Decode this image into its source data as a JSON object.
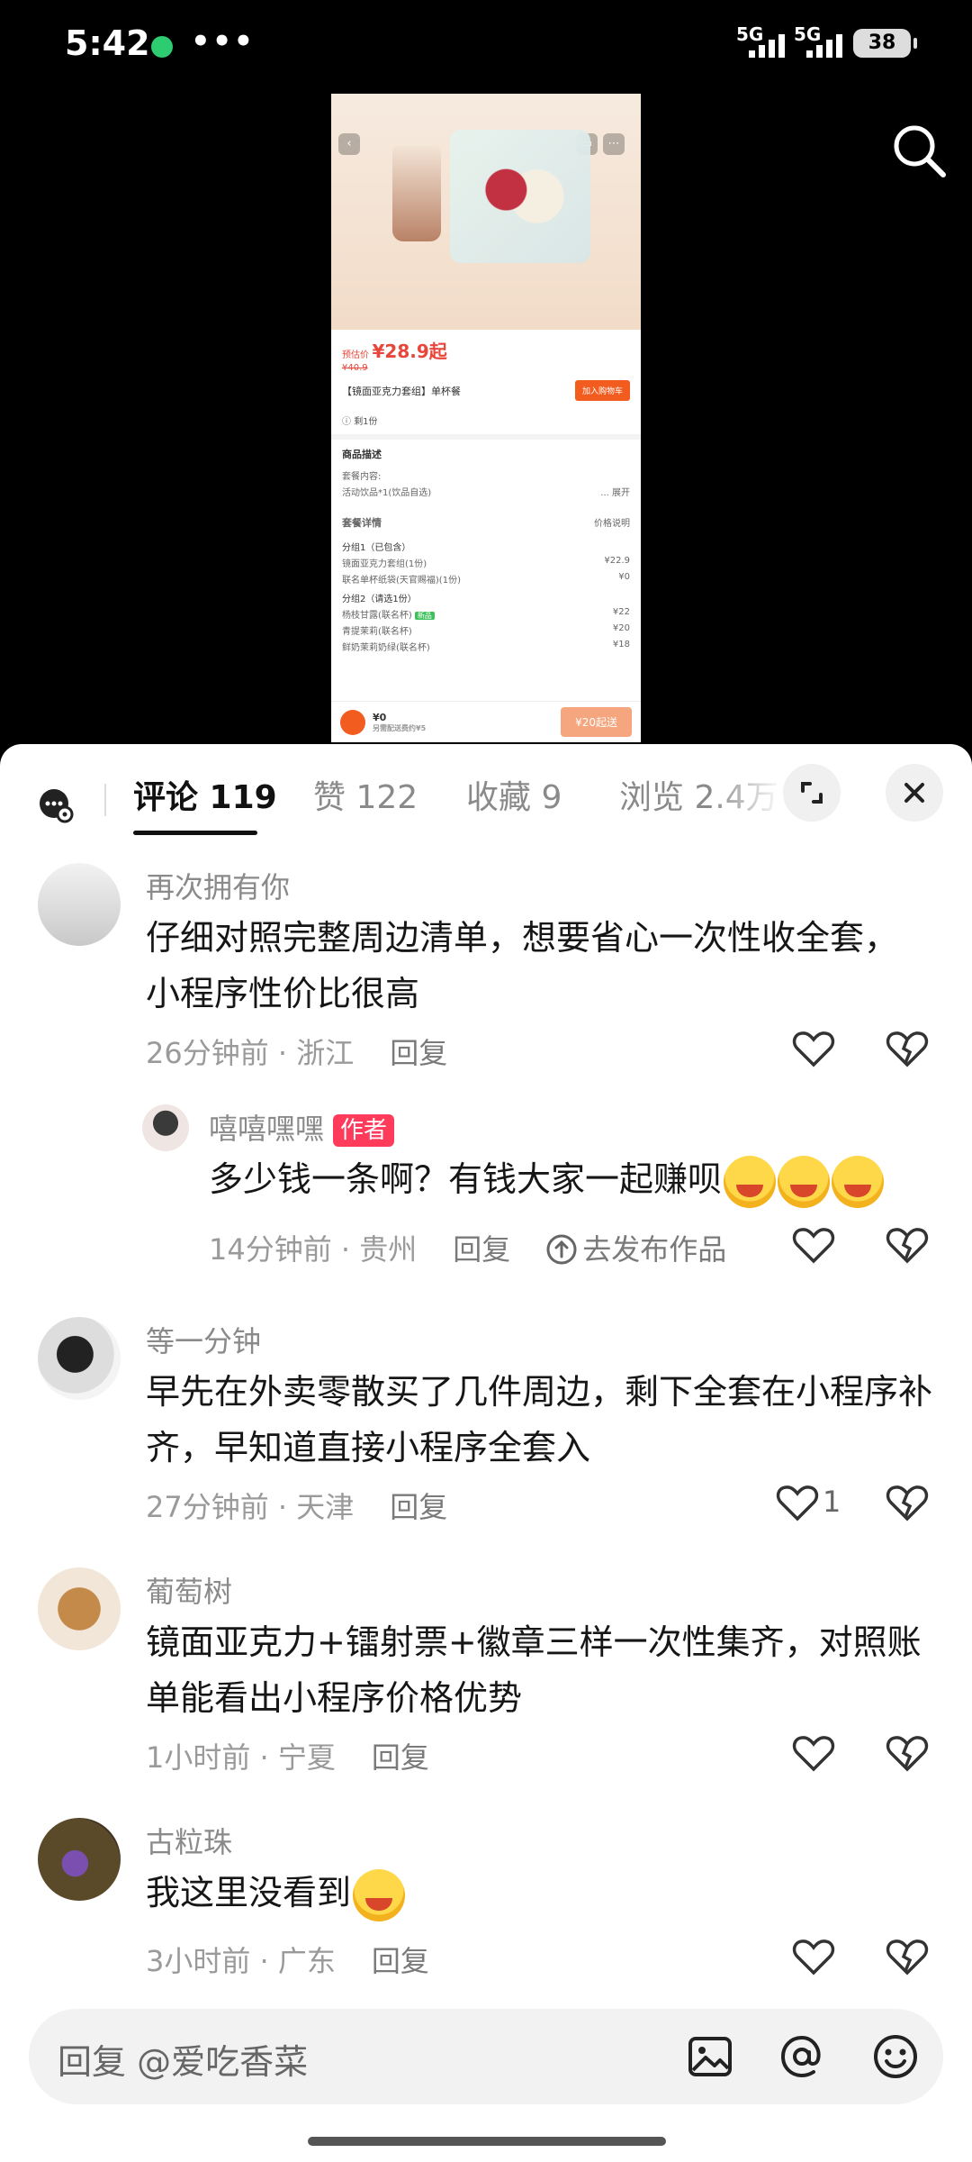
{
  "status_bar": {
    "time": "5:42",
    "more": "•••",
    "net1": "5G",
    "net2": "5G",
    "battery": "38"
  },
  "product_preview": {
    "price_label": "预估价",
    "price": "¥28.9起",
    "old_price": "¥40.9",
    "title": "【镜面亚克力套组】单杯餐",
    "add_to_cart": "加入购物车",
    "left_count": "剩1份",
    "desc_title": "商品描述",
    "desc_sub": "套餐内容:",
    "desc_line": "活动饮品*1(饮品自选)",
    "desc_expand": "... 展开",
    "detail_title": "套餐详情",
    "price_note": "价格说明",
    "group1": "分组1（已包含）",
    "g1_items": [
      {
        "name": "镜面亚克力套组(1份)",
        "price": "¥22.9"
      },
      {
        "name": "联名单杯纸袋(天官赐福)(1份)",
        "price": "¥0"
      }
    ],
    "group2": "分组2（请选1份）",
    "g2_items": [
      {
        "name": "杨枝甘露(联名杯)",
        "price": "¥22",
        "tag": "新品"
      },
      {
        "name": "青提茉莉(联名杯)",
        "price": "¥20"
      },
      {
        "name": "鲜奶茉莉奶绿(联名杯)",
        "price": "¥18"
      }
    ],
    "total": "¥0",
    "total_sub": "另需配送费约¥5",
    "checkout": "¥20起送"
  },
  "tabs": [
    {
      "label": "评论 119"
    },
    {
      "label": "赞 122"
    },
    {
      "label": "收藏 9"
    },
    {
      "label": "浏览 2.4万"
    }
  ],
  "comments": [
    {
      "user": "再次拥有你",
      "text": "仔细对照完整周边清单，想要省心一次性收全套，小程序性价比很高",
      "time": "26分钟前",
      "location": "浙江",
      "reply": "回复"
    },
    {
      "user": "嘻嘻嘿嘿",
      "author_tag": "作者",
      "text": "多少钱一条啊？有钱大家一起赚呗",
      "time": "14分钟前",
      "location": "贵州",
      "reply": "回复",
      "publish": "去发布作品"
    },
    {
      "user": "等一分钟",
      "text": "早先在外卖零散买了几件周边，剩下全套在小程序补齐，早知道直接小程序全套入",
      "time": "27分钟前",
      "location": "天津",
      "reply": "回复",
      "likes": "1"
    },
    {
      "user": "葡萄树",
      "text": "镜面亚克力+镭射票+徽章三样一次性集齐，对照账单能看出小程序价格优势",
      "time": "1小时前",
      "location": "宁夏",
      "reply": "回复"
    },
    {
      "user": "古粒珠",
      "text": "我这里没看到",
      "time": "3小时前",
      "location": "广东",
      "reply": "回复"
    }
  ],
  "meta_sep": " · ",
  "input": {
    "placeholder": "回复 @爱吃香菜"
  },
  "colors": {
    "author_tag": "#ff3b5c",
    "accent_orange": "#f25c1f",
    "price_red": "#e8463a"
  }
}
